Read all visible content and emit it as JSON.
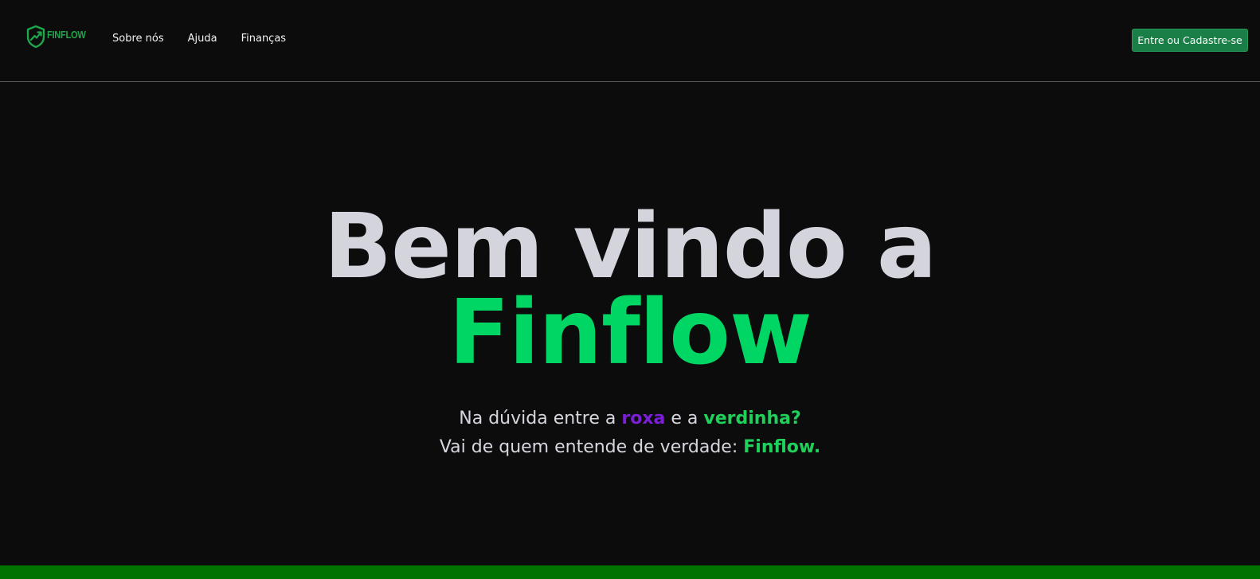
{
  "brand": {
    "name": "FINFLOW",
    "logo_icon": "shield-chart-icon",
    "color": "#1fa64a"
  },
  "nav": {
    "items": [
      {
        "label": "Sobre nós"
      },
      {
        "label": "Ajuda"
      },
      {
        "label": "Finanças"
      }
    ]
  },
  "auth": {
    "button_label": "Entre ou Cadastre-se",
    "color": "#1a7f47"
  },
  "hero": {
    "title_line1": "Bem vindo a",
    "title_line2": "Finflow",
    "subtitle_line1": {
      "part1": "Na dúvida entre a ",
      "roxa": "roxa",
      "part2": " e a ",
      "verdinha": "verdinha?"
    },
    "subtitle_line2": {
      "part1": "Vai de quem entende de verdade: ",
      "brand": "Finflow."
    }
  },
  "colors": {
    "background": "#0c0c0d",
    "accent_green": "#00d663",
    "accent_purple": "#7b1fd6",
    "footer_bar": "#007300"
  }
}
